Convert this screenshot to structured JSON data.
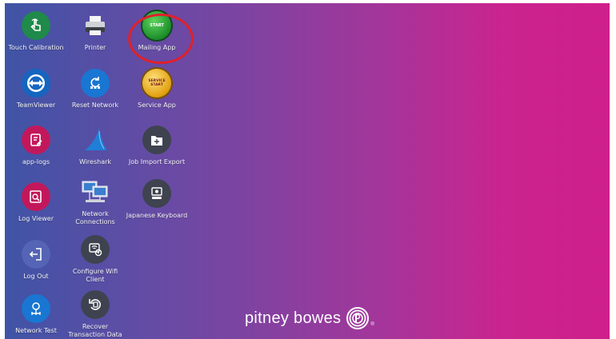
{
  "colors": {
    "gradient_left": "#3f54a6",
    "gradient_right": "#cf1f8b",
    "highlight_ring": "#e0202a"
  },
  "desktop": {
    "icons": [
      {
        "label": "Touch Calibration",
        "icon": "touch-hand-icon"
      },
      {
        "label": "Printer",
        "icon": "printer-icon"
      },
      {
        "label": "Mailing App",
        "icon": "start-button-icon",
        "badge_text": "START"
      },
      {
        "label": "TeamViewer",
        "icon": "teamviewer-icon"
      },
      {
        "label": "Reset Network",
        "icon": "reset-network-icon"
      },
      {
        "label": "Service App",
        "icon": "service-start-icon",
        "badge_text": "SERVICE START"
      },
      {
        "label": "app-logs",
        "icon": "app-logs-icon"
      },
      {
        "label": "Wireshark",
        "icon": "wireshark-fin-icon"
      },
      {
        "label": "Job Import Export",
        "icon": "job-import-export-icon"
      },
      {
        "label": "Log Viewer",
        "icon": "log-viewer-icon"
      },
      {
        "label": "Network Connections",
        "icon": "network-computers-icon"
      },
      {
        "label": "Japanese Keyboard",
        "icon": "japanese-keyboard-icon"
      },
      {
        "label": "Log Out",
        "icon": "log-out-icon"
      },
      {
        "label": "Configure Wifi Client",
        "icon": "wifi-config-icon"
      },
      {
        "label": "Network Test",
        "icon": "network-test-icon"
      },
      {
        "label": "Recover Transaction Data",
        "icon": "recover-data-icon"
      }
    ]
  },
  "brand": {
    "name": "pitney bowes",
    "registered": "®"
  }
}
